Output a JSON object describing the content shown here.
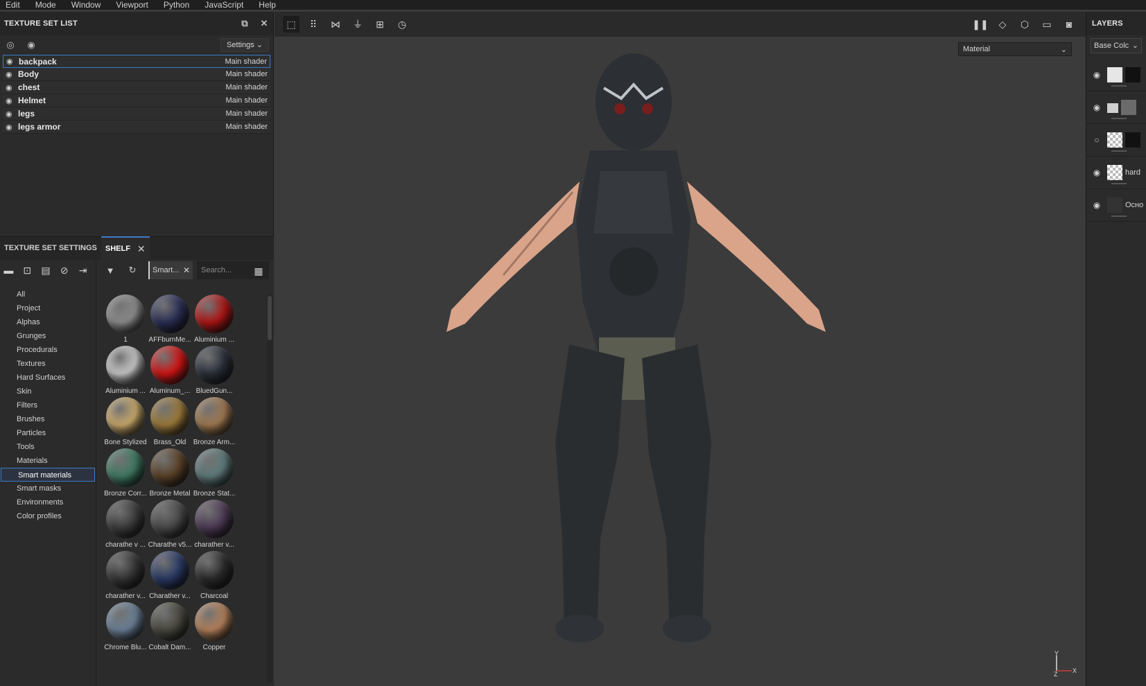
{
  "menu": [
    "Edit",
    "Mode",
    "Window",
    "Viewport",
    "Python",
    "JavaScript",
    "Help"
  ],
  "texture_set_list": {
    "title": "TEXTURE SET LIST",
    "settings_label": "Settings",
    "rows": [
      {
        "name": "backpack",
        "shader": "Main shader"
      },
      {
        "name": "Body",
        "shader": "Main shader"
      },
      {
        "name": "chest",
        "shader": "Main shader"
      },
      {
        "name": "Helmet",
        "shader": "Main shader"
      },
      {
        "name": "legs",
        "shader": "Main shader"
      },
      {
        "name": "legs armor",
        "shader": "Main shader"
      }
    ]
  },
  "tabs": {
    "texture_set_settings": "TEXTURE SET SETTINGS",
    "shelf": "SHELF"
  },
  "shelf": {
    "filter_chip": "Smart...",
    "search_placeholder": "Search...",
    "categories": [
      "All",
      "Project",
      "Alphas",
      "Grunges",
      "Procedurals",
      "Textures",
      "Hard Surfaces",
      "Skin",
      "Filters",
      "Brushes",
      "Particles",
      "Tools",
      "Materials",
      "Smart materials",
      "Smart masks",
      "Environments",
      "Color profiles"
    ],
    "selected_category": "Smart materials",
    "materials": [
      {
        "label": "1",
        "color": "#8c8c8c"
      },
      {
        "label": "AFFburnMe...",
        "color": "#2a2f55"
      },
      {
        "label": "Aluminium ...",
        "color": "#b01515"
      },
      {
        "label": "Aluminium ...",
        "color": "#c8c8c8"
      },
      {
        "label": "Aluminum_...",
        "color": "#d11414"
      },
      {
        "label": "BluedGun...",
        "color": "#2a2f3a"
      },
      {
        "label": "Bone Stylized",
        "color": "#c9a96a"
      },
      {
        "label": "Brass_Old",
        "color": "#9c7a3a"
      },
      {
        "label": "Bronze Arm...",
        "color": "#a07850"
      },
      {
        "label": "Bronze Corr...",
        "color": "#3f7a64"
      },
      {
        "label": "Bronze Metal",
        "color": "#5a4128"
      },
      {
        "label": "Bronze Stat...",
        "color": "#5f7a7a"
      },
      {
        "label": "charathe v ...",
        "color": "#3d3d3d"
      },
      {
        "label": "Charathe v5...",
        "color": "#4a4a4a"
      },
      {
        "label": "charather v...",
        "color": "#4d3a55"
      },
      {
        "label": "charather v...",
        "color": "#353535"
      },
      {
        "label": "Charather v...",
        "color": "#2a3a66"
      },
      {
        "label": "Charcoal",
        "color": "#2a2a2a"
      },
      {
        "label": "Chrome Blu...",
        "color": "#6a7f96"
      },
      {
        "label": "Cobalt Dam...",
        "color": "#4a4a40"
      },
      {
        "label": "Copper",
        "color": "#b4805a"
      }
    ]
  },
  "viewport": {
    "mode_dropdown": "Material",
    "axis_y": "Y",
    "axis_z": "Z",
    "axis_x": "X"
  },
  "layers": {
    "title": "LAYERS",
    "channel": "Base Colc",
    "items": [
      {
        "name": ""
      },
      {
        "name": ""
      },
      {
        "name": ""
      },
      {
        "name": "hard"
      },
      {
        "name": "Осно"
      }
    ]
  }
}
